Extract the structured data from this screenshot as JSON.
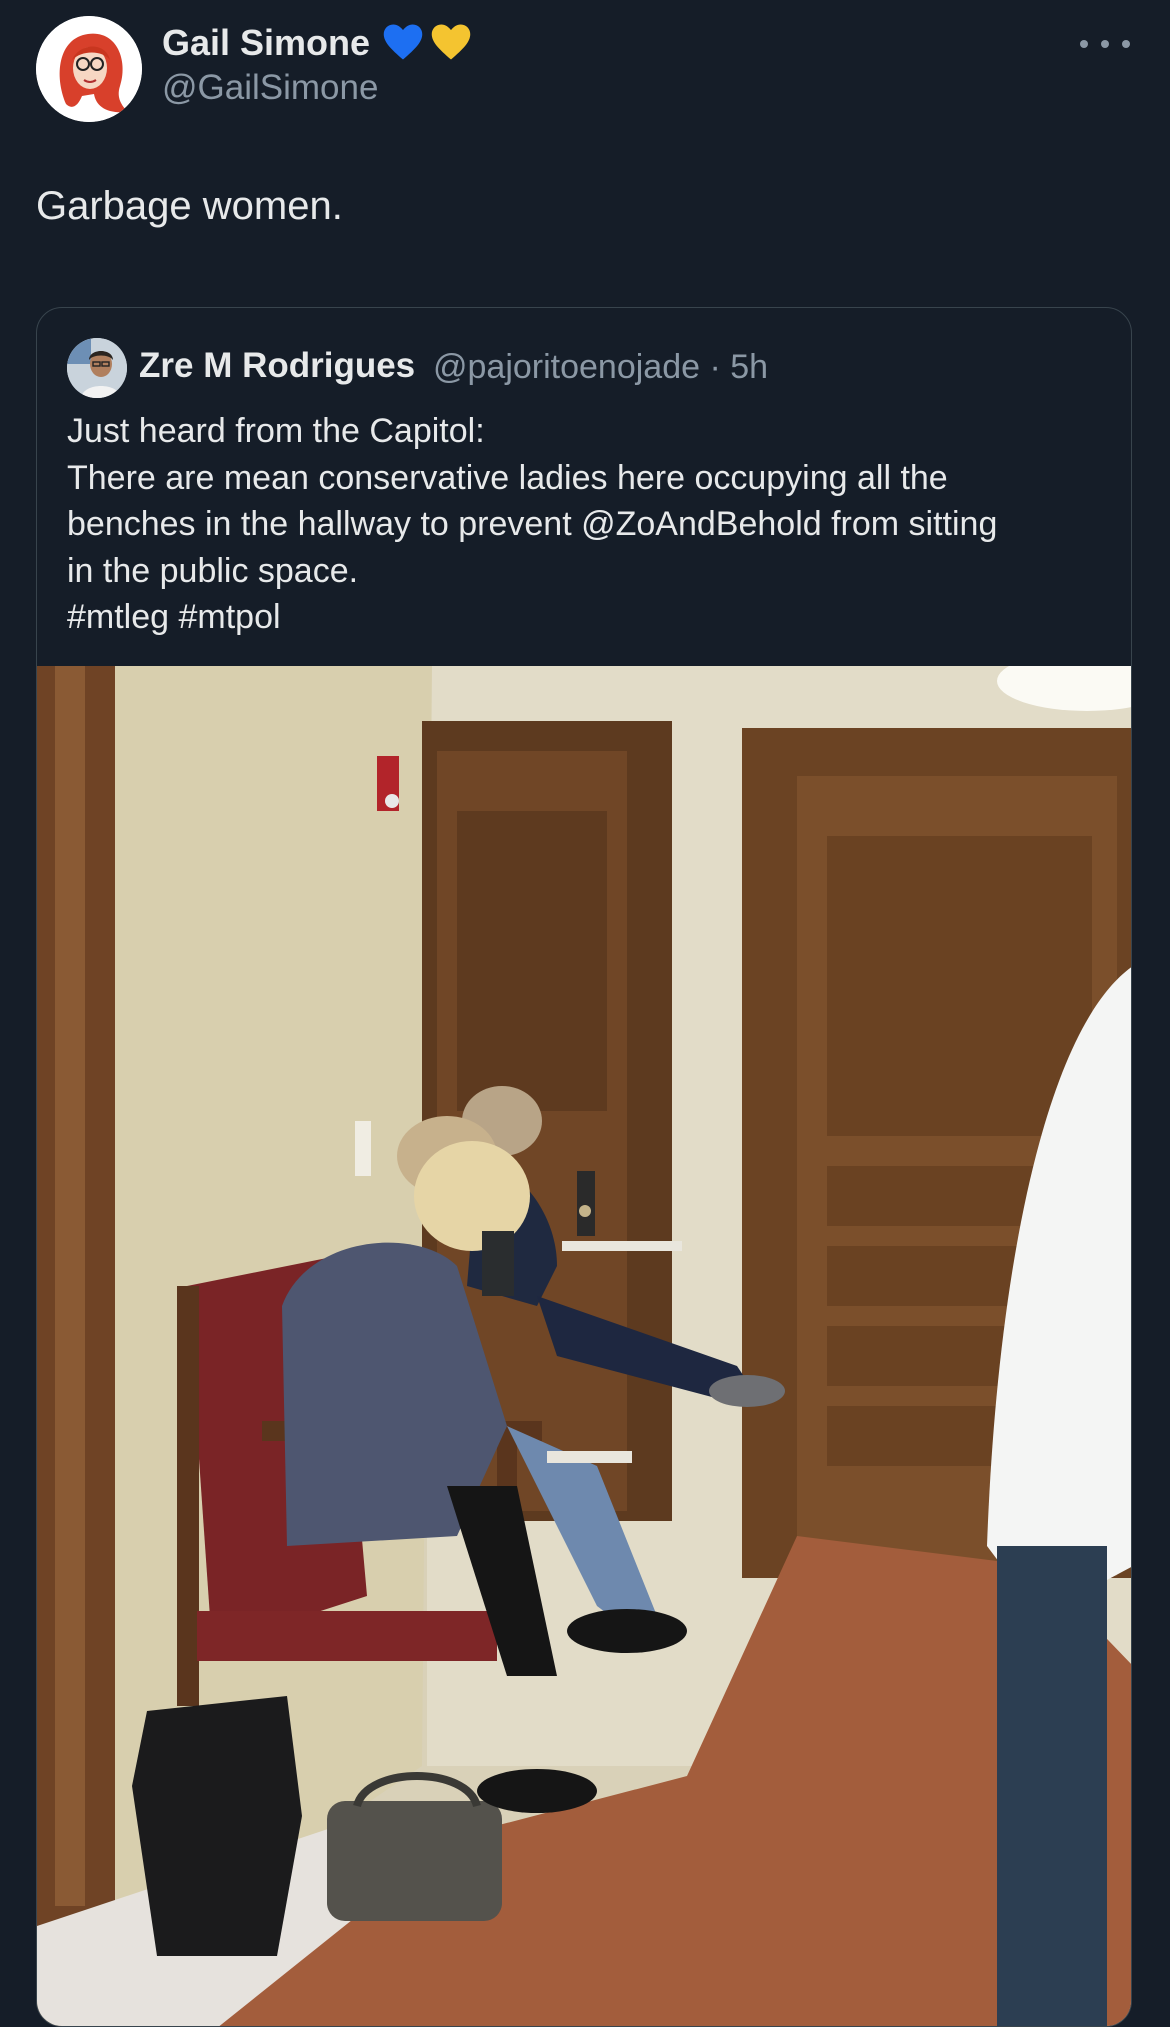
{
  "tweet": {
    "author_name": "Gail Simone",
    "author_handle": "@GailSimone",
    "badges": [
      "blue-heart-icon",
      "yellow-heart-icon"
    ],
    "text": "Garbage women."
  },
  "quoted_tweet": {
    "author_name": "Zre M Rodrigues",
    "author_handle": "@pajoritoenojade",
    "time": "5h",
    "text_lines": [
      "Just heard from the Capitol:",
      "There are mean conservative ladies here occupying all the",
      "benches in the hallway to prevent @ZoAndBehold from sitting",
      "in the public space.",
      "#mtleg #mtpol"
    ]
  },
  "colors": {
    "background": "#151d28",
    "text_primary": "#e7e9ea",
    "text_secondary": "#8b98a5",
    "border": "#38444d",
    "blue_heart": "#1d6ff2",
    "yellow_heart": "#f4c430"
  }
}
